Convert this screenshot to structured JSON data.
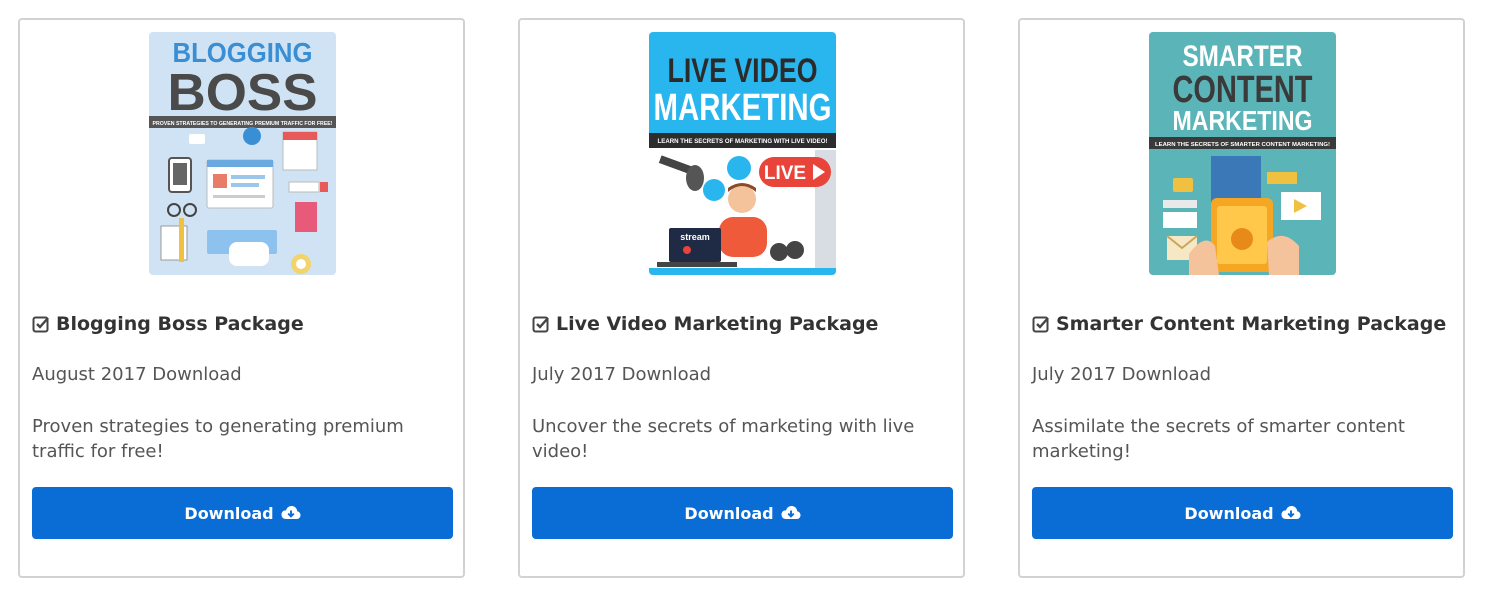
{
  "products": [
    {
      "title": "Blogging Boss Package",
      "date": "August 2017 Download",
      "description": "Proven strategies to generating premium traffic for free!",
      "button": "Download",
      "cover": {
        "line1": "BLOGGING",
        "line2": "BOSS",
        "tagline": "PROVEN STRATEGIES TO GENERATING PREMIUM TRAFFIC FOR FREE!",
        "icon": "blogging-illustration",
        "bg": "#cfe3f5"
      }
    },
    {
      "title": "Live Video Marketing Package",
      "date": "July 2017 Download",
      "description": "Uncover the secrets of marketing with live video!",
      "button": "Download",
      "cover": {
        "line1": "LIVE VIDEO",
        "line2": "MARKETING",
        "tagline": "LEARN THE SECRETS OF MARKETING WITH LIVE VIDEO!",
        "badge": "LIVE",
        "stream": "stream",
        "icon": "live-video-illustration",
        "bg": "#29b6ee"
      }
    },
    {
      "title": "Smarter Content Marketing Package",
      "date": "July 2017 Download",
      "description": "Assimilate the secrets of smarter content marketing!",
      "button": "Download",
      "cover": {
        "line1": "SMARTER",
        "line2": "CONTENT",
        "line3": "MARKETING",
        "tagline": "LEARN THE SECRETS OF SMARTER CONTENT MARKETING!",
        "icon": "content-marketing-illustration",
        "bg": "#5bb5b8"
      }
    }
  ],
  "icons": {
    "title_icon": "check-square-icon",
    "button_icon": "cloud-download-icon"
  },
  "colors": {
    "button": "#0a6dd6",
    "card_border": "#d2d2d2"
  }
}
